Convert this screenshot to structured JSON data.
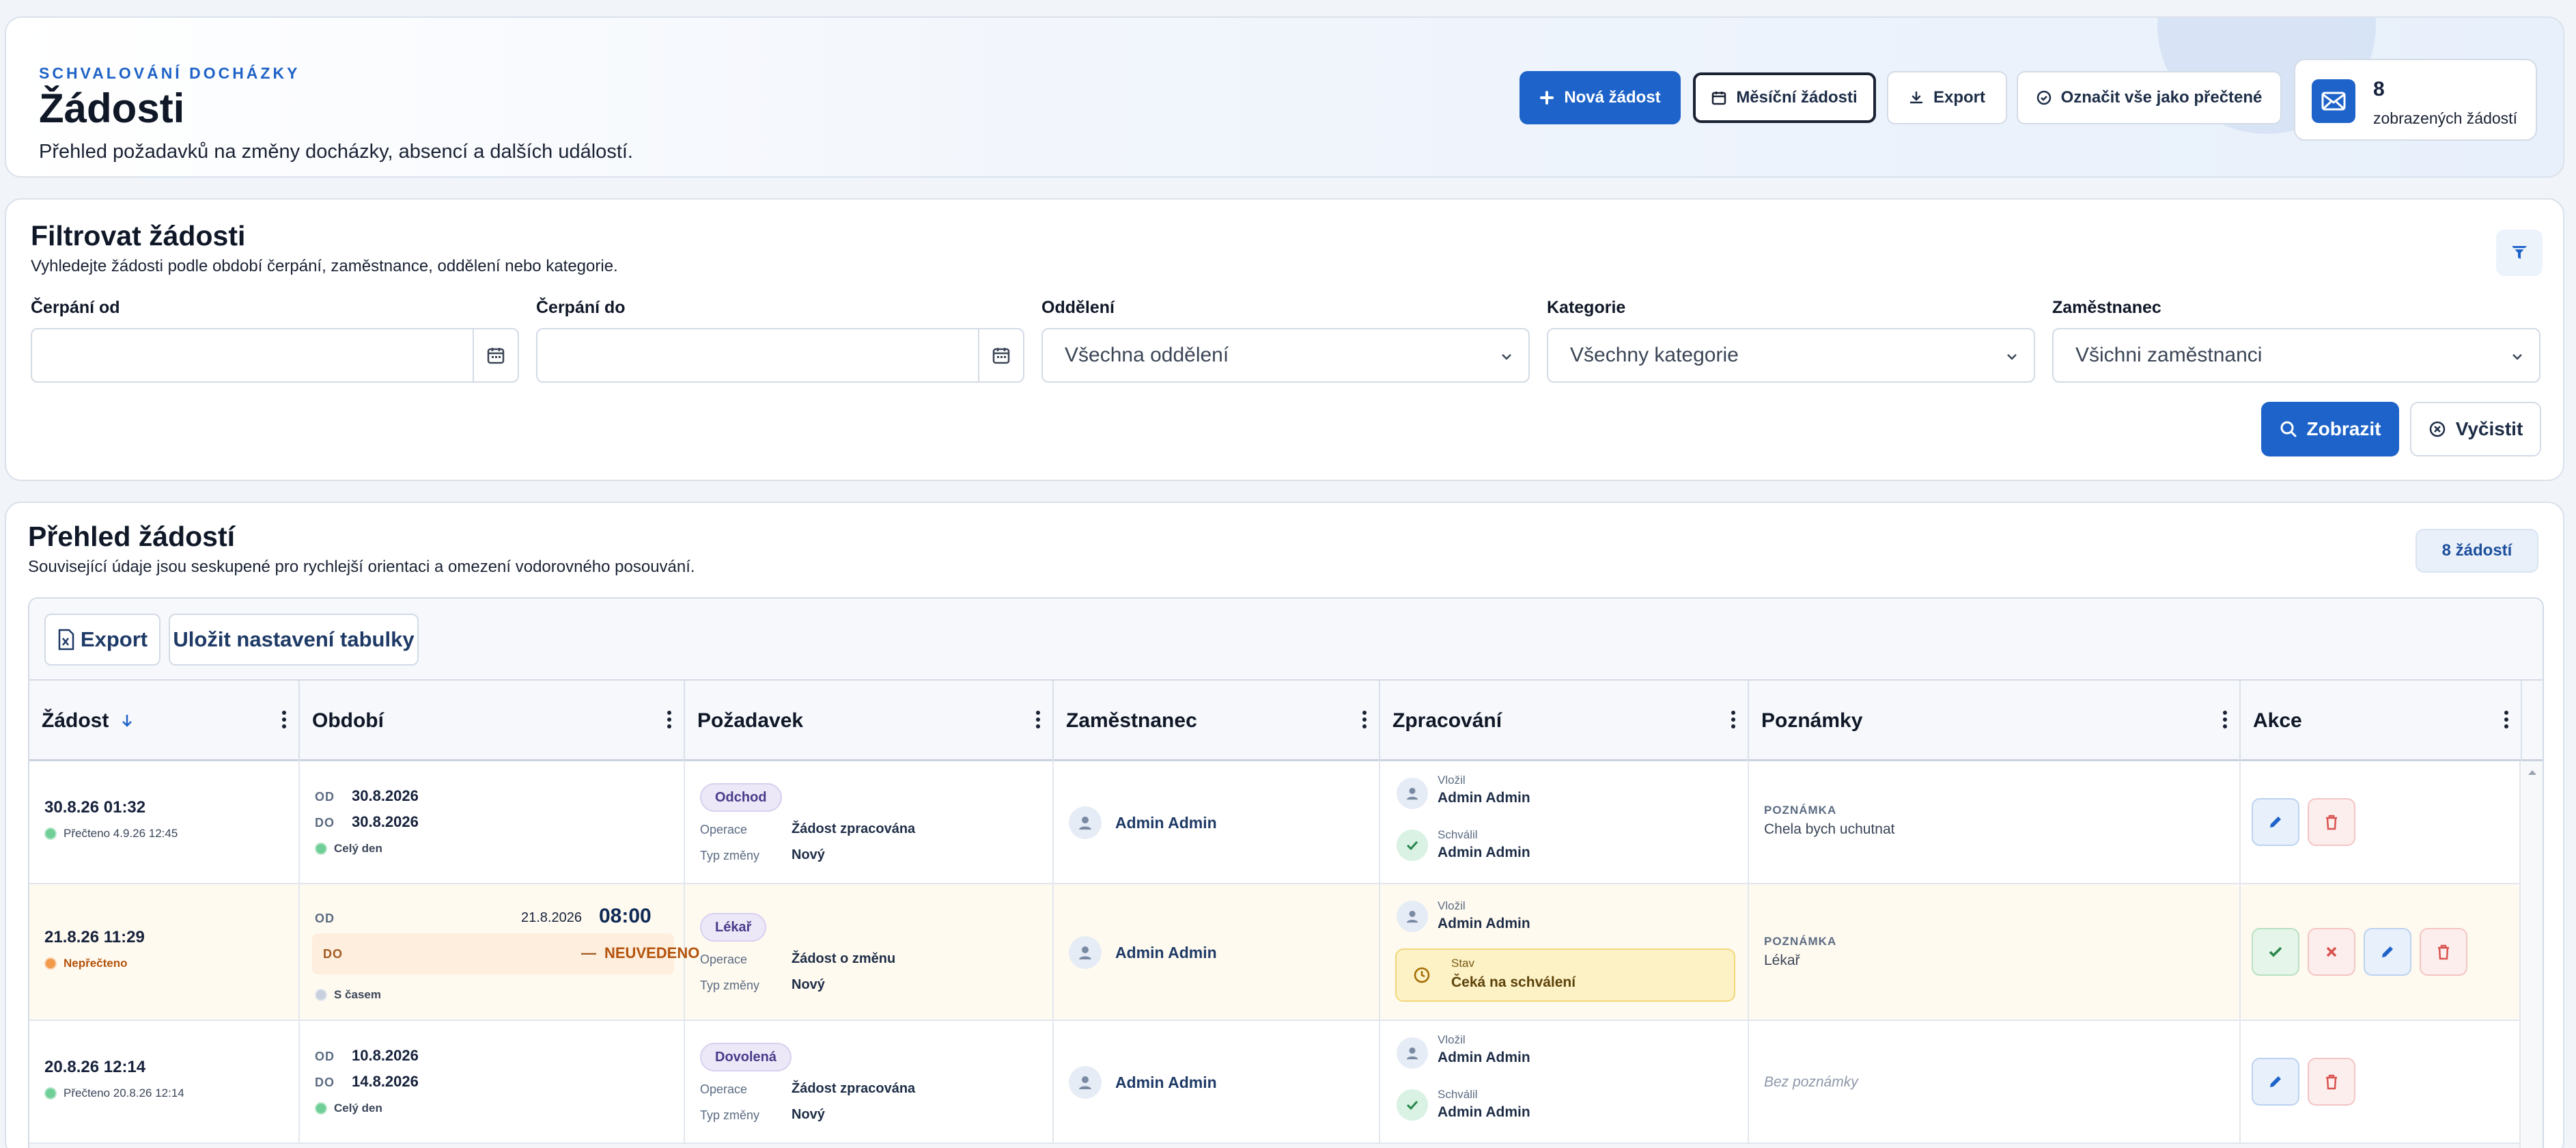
{
  "header": {
    "eyebrow": "SCHVALOVÁNÍ DOCHÁZKY",
    "title": "Žádosti",
    "subtitle": "Přehled požadavků na změny docházky, absencí a dalších událostí.",
    "buttons": {
      "new": "Nová žádost",
      "monthly": "Měsíční žádosti",
      "export": "Export",
      "mark_read": "Označit vše jako přečtené"
    },
    "stat": {
      "count": "8",
      "label": "zobrazených žádostí"
    }
  },
  "filter": {
    "title": "Filtrovat žádosti",
    "subtitle": "Vyhledejte žádosti podle období čerpání, zaměstnance, oddělení nebo kategorie.",
    "date_from_label": "Čerpání od",
    "date_to_label": "Čerpání do",
    "department_label": "Oddělení",
    "department_value": "Všechna oddělení",
    "category_label": "Kategorie",
    "category_value": "Všechny kategorie",
    "employee_label": "Zaměstnanec",
    "employee_value": "Všichni zaměstnanci",
    "show_button": "Zobrazit",
    "clear_button": "Vyčistit"
  },
  "overview": {
    "title": "Přehled žádostí",
    "subtitle": "Související údaje jsou seskupené pro rychlejší orientaci a omezení vodorovného posouvání.",
    "count_badge": "8 žádostí",
    "toolbar": {
      "export": "Export",
      "save_settings": "Uložit nastavení tabulky"
    },
    "columns": [
      "Žádost",
      "Období",
      "Požadavek",
      "Zaměstnanec",
      "Zpracování",
      "Poznámky",
      "Akce"
    ],
    "labels": {
      "od": "OD",
      "do": "DO",
      "operation": "Operace",
      "change_type": "Typ změny",
      "inserted": "Vložil",
      "approved": "Schválil",
      "state": "Stav",
      "note": "POZNÁMKA",
      "no_note": "Bez poznámky"
    },
    "rows": [
      {
        "date": "30.8.26 01:32",
        "read_status": "Přečteno 4.9.26 12:45",
        "from": "30.8.2026",
        "to": "30.8.2026",
        "duration": "Celý den",
        "tag": "Odchod",
        "operation": "Žádost zpracována",
        "change_type": "Nový",
        "employee": "Admin Admin",
        "inserted_by": "Admin Admin",
        "approved_by": "Admin Admin",
        "note": "Chela bych uchutnat"
      },
      {
        "date": "21.8.26 11:29",
        "read_status": "Nepřečteno",
        "from_date": "21.8.2026",
        "from_time": "08:00",
        "to_dash": "—",
        "to_value": "NEUVEDENO",
        "duration": "S časem",
        "tag": "Lékař",
        "operation": "Žádost o změnu",
        "change_type": "Nový",
        "employee": "Admin Admin",
        "inserted_by": "Admin Admin",
        "state": "Čeká na schválení",
        "note": "Lékař"
      },
      {
        "date": "20.8.26 12:14",
        "read_status": "Přečteno 20.8.26 12:14",
        "from": "10.8.2026",
        "to": "14.8.2026",
        "duration": "Celý den",
        "tag": "Dovolená",
        "operation": "Žádost zpracována",
        "change_type": "Nový",
        "employee": "Admin Admin",
        "inserted_by": "Admin Admin",
        "approved_by": "Admin Admin"
      }
    ]
  }
}
